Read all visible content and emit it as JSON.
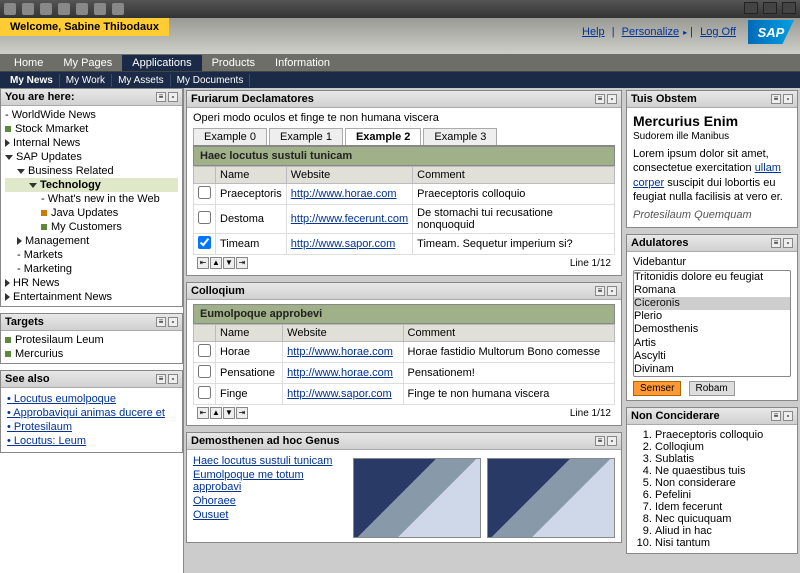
{
  "welcome": "Welcome, Sabine Thibodaux",
  "toplinks": {
    "help": "Help",
    "personalize": "Personalize",
    "logoff": "Log Off"
  },
  "logo": "SAP",
  "tabs": [
    "Home",
    "My Pages",
    "Applications",
    "Products",
    "Information"
  ],
  "active_tab": "Applications",
  "subtabs": [
    "My News",
    "My Work",
    "My Assets",
    "My Documents"
  ],
  "nav": {
    "title": "You are here:",
    "items": [
      {
        "label": "WorldWide News",
        "level": 0,
        "arrow": "none"
      },
      {
        "label": "Stock Mmarket",
        "level": 0,
        "arrow": "none",
        "bullet": "green"
      },
      {
        "label": "Internal News",
        "level": 0,
        "arrow": "right"
      },
      {
        "label": "SAP Updates",
        "level": 0,
        "arrow": "down"
      },
      {
        "label": "Business Related",
        "level": 1,
        "arrow": "down"
      },
      {
        "label": "Technology",
        "level": 2,
        "arrow": "down",
        "selected": true
      },
      {
        "label": "What's new in the Web",
        "level": 3
      },
      {
        "label": "Java Updates",
        "level": 3,
        "bullet": "orange"
      },
      {
        "label": "My Customers",
        "level": 3,
        "bullet": "green"
      },
      {
        "label": "Management",
        "level": 1,
        "arrow": "right"
      },
      {
        "label": "Markets",
        "level": 1
      },
      {
        "label": "Marketing",
        "level": 1
      },
      {
        "label": "HR News",
        "level": 0,
        "arrow": "right"
      },
      {
        "label": "Entertainment News",
        "level": 0,
        "arrow": "right"
      }
    ]
  },
  "targets": {
    "title": "Targets",
    "items": [
      "Protesilaum Leum",
      "Mercurius"
    ]
  },
  "seealso": {
    "title": "See also",
    "items": [
      "Locutus eumolpoque",
      "Approbaviqui animas ducere et",
      "Protesilaum",
      "Locutus: Leum"
    ]
  },
  "decl": {
    "title": "Furiarum Declamatores",
    "sub": "Operi modo oculos et finge te non humana viscera",
    "tabs": [
      "Example 0",
      "Example 1",
      "Example 2",
      "Example 3"
    ],
    "active_tab": "Example 2",
    "tablehead": "Haec locutus sustuli tunicam",
    "cols": [
      "Name",
      "Website",
      "Comment"
    ],
    "rows": [
      {
        "chk": false,
        "name": "Praeceptoris",
        "site": "http://www.horae.com",
        "comment": "Praeceptoris colloquio"
      },
      {
        "chk": false,
        "name": "Destoma",
        "site": "http://www.fecerunt.com",
        "comment": "De stomachi tui recusatione nonquoquid"
      },
      {
        "chk": true,
        "name": "Timeam",
        "site": "http://www.sapor.com",
        "comment": "Timeam. Sequetur imperium si?"
      }
    ],
    "footer": "Line 1/12"
  },
  "coll": {
    "title": "Colloqium",
    "tablehead": "Eumolpoque approbevi",
    "cols": [
      "Name",
      "Website",
      "Comment"
    ],
    "rows": [
      {
        "name": "Horae",
        "site": "http://www.horae.com",
        "comment": "Horae fastidio Multorum Bono comesse"
      },
      {
        "name": "Pensatione",
        "site": "http://www.horae.com",
        "comment": "Pensationem!"
      },
      {
        "name": "Finge",
        "site": "http://www.sapor.com",
        "comment": "Finge te non humana viscera"
      }
    ],
    "footer": "Line 1/12"
  },
  "demo": {
    "title": "Demosthenen ad hoc Genus",
    "links": [
      "Haec locutus sustuli tunicam",
      "Eumolpoque me totum approbavi",
      "Ohoraee",
      "Ousuet"
    ]
  },
  "tuis": {
    "title": "Tuis Obstem",
    "heading": "Mercurius Enim",
    "sub": "Sudorem ille Manibus",
    "body": "Lorem ipsum dolor sit amet, consectetue exercitation ",
    "link": "ullam corper",
    "body2": " suscipit dui lobortis eu feugiat nulla facilisis at vero er.",
    "sig": "Protesilaum Quemquam"
  },
  "adul": {
    "title": "Adulatores",
    "label": "Videbantur",
    "options": [
      "Tritonidis dolore eu feugiat",
      "Romana",
      "Ciceronis",
      "Plerio",
      "Demosthenis",
      "Artis",
      "Ascylti",
      "Divinam"
    ],
    "selected": "Ciceronis",
    "btn1": "Semser",
    "btn2": "Robam"
  },
  "nonc": {
    "title": "Non Conciderare",
    "items": [
      "Praeceptoris colloquio",
      "Colloqium",
      "Sublatis",
      "Ne quaestibus tuis",
      "Non considerare",
      "Pefelini",
      "Idem fecerunt",
      "Nec quicuquam",
      "Aliud in hac",
      "Nisi tantum"
    ]
  }
}
